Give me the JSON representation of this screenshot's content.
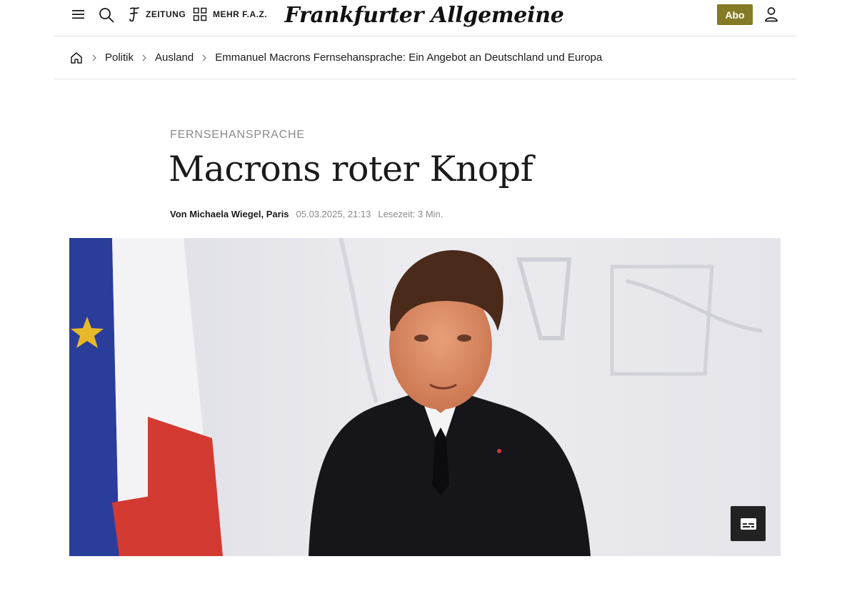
{
  "header": {
    "zeitung_label": "ZEITUNG",
    "mehr_label": "MEHR F.A.Z.",
    "logo_text": "Frankfurter Allgemeine",
    "abo_label": "Abo",
    "brand_color": "#857a25"
  },
  "breadcrumb": {
    "items": [
      "Politik",
      "Ausland",
      "Emmanuel Macrons Fernsehansprache: Ein Angebot an Deutschland und Europa"
    ]
  },
  "article": {
    "kicker": "FERNSEHANSPRACHE",
    "title": "Macrons roter Knopf",
    "author": "Von Michaela Wiegel, Paris",
    "date": "05.03.2025, 21:13",
    "reading_time": "Lesezeit: 3 Min."
  },
  "icons": {
    "menu": "menu-icon",
    "search": "search-icon",
    "faz_f": "faz-f-icon",
    "grid": "grid-icon",
    "user": "user-icon",
    "home": "home-icon",
    "chevron": "chevron-right-icon",
    "subtitles": "subtitles-icon"
  }
}
